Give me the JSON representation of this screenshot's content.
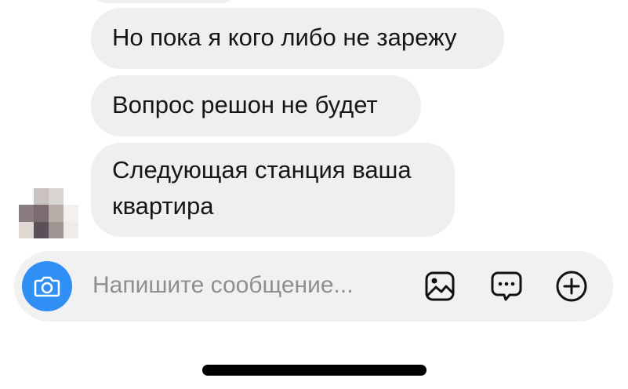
{
  "messages": [
    {
      "text": "Но пока я кого либо не зарежу"
    },
    {
      "text": "Вопрос решон не будет"
    },
    {
      "text": "Следующая станция ваша квартира"
    }
  ],
  "composer": {
    "placeholder": "Напишите сообщение..."
  },
  "icons": {
    "camera": "camera-icon",
    "gallery": "image-icon",
    "sticker": "chat-bubble-icon",
    "more": "plus-icon"
  },
  "colors": {
    "accent": "#2f8ff5",
    "bubble": "#efefef",
    "composer": "#f1f1f1",
    "placeholder": "#8e8e8e"
  },
  "avatar": {
    "state": "pixelated"
  }
}
